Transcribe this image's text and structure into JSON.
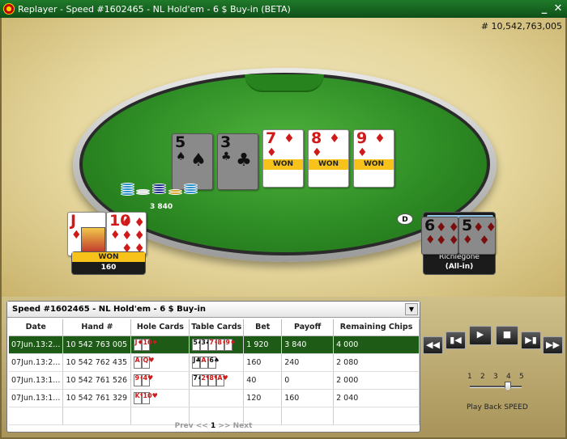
{
  "window": {
    "title": "Replayer - Speed #1602465 - NL Hold'em - 6 $ Buy-in (BETA)",
    "minimize": "_",
    "close": "✕"
  },
  "hand_number": "# 10,542,763,005",
  "board": [
    {
      "rank": "5",
      "suit": "♠",
      "color": "black",
      "dim": true,
      "won": ""
    },
    {
      "rank": "3",
      "suit": "♣",
      "color": "black",
      "dim": true,
      "won": ""
    },
    {
      "rank": "7",
      "suit": "♦",
      "color": "red",
      "dim": false,
      "won": "WON"
    },
    {
      "rank": "8",
      "suit": "♦",
      "color": "red",
      "dim": false,
      "won": "WON"
    },
    {
      "rank": "9",
      "suit": "♦",
      "color": "red",
      "dim": false,
      "won": "WON"
    }
  ],
  "pot": "3 840",
  "dealer_button": "D",
  "hero": {
    "cards": [
      {
        "rank": "J",
        "suit": "♦",
        "color": "red"
      },
      {
        "rank": "10",
        "suit": "♦",
        "color": "red"
      }
    ],
    "status": "WON",
    "chips": "160"
  },
  "villain": {
    "cards": [
      {
        "rank": "6",
        "suit": "♦",
        "color": "red"
      },
      {
        "rank": "5",
        "suit": "♦",
        "color": "red"
      }
    ],
    "name": "Richiegone",
    "status": "(All-in)"
  },
  "history": {
    "title": "Speed #1602465 - NL Hold'em - 6 $ Buy-in",
    "columns": [
      "Date",
      "Hand #",
      "Hole Cards",
      "Table Cards",
      "Bet",
      "Payoff",
      "Remaining Chips"
    ],
    "rows": [
      {
        "date": "07Jun.13:2...",
        "hand": "10 542 763 005",
        "hole": [
          "J♦",
          "10♦"
        ],
        "table": [
          "5♠",
          "3♣",
          "7♦",
          "8♦",
          "9♦"
        ],
        "bet": "1 920",
        "payoff": "3 840",
        "remaining": "4 000"
      },
      {
        "date": "07Jun.13:2...",
        "hand": "10 542 762 435",
        "hole": [
          "A♦",
          "Q♥"
        ],
        "table": [
          "J♣",
          "A♦",
          "6♠"
        ],
        "bet": "160",
        "payoff": "240",
        "remaining": "2 080"
      },
      {
        "date": "07Jun.13:1...",
        "hand": "10 542 761 526",
        "hole": [
          "9♦",
          "4♥"
        ],
        "table": [
          "7♠",
          "2♥",
          "8♥",
          "A♥"
        ],
        "bet": "40",
        "payoff": "0",
        "remaining": "2 000"
      },
      {
        "date": "07Jun.13:1...",
        "hand": "10 542 761 329",
        "hole": [
          "K♥",
          "10♥"
        ],
        "table": [],
        "bet": "120",
        "payoff": "160",
        "remaining": "2 040"
      }
    ],
    "pager": {
      "prev": "Prev <<",
      "page": "1",
      "next": ">> Next"
    }
  },
  "playback": {
    "speeds": [
      "1",
      "2",
      "3",
      "4",
      "5"
    ],
    "selected_speed": 4,
    "label": "Play Back SPEED"
  },
  "colors": {
    "selected_row": "#1e5b16",
    "won": "#f7c31b",
    "felt": "#2e8c25"
  }
}
